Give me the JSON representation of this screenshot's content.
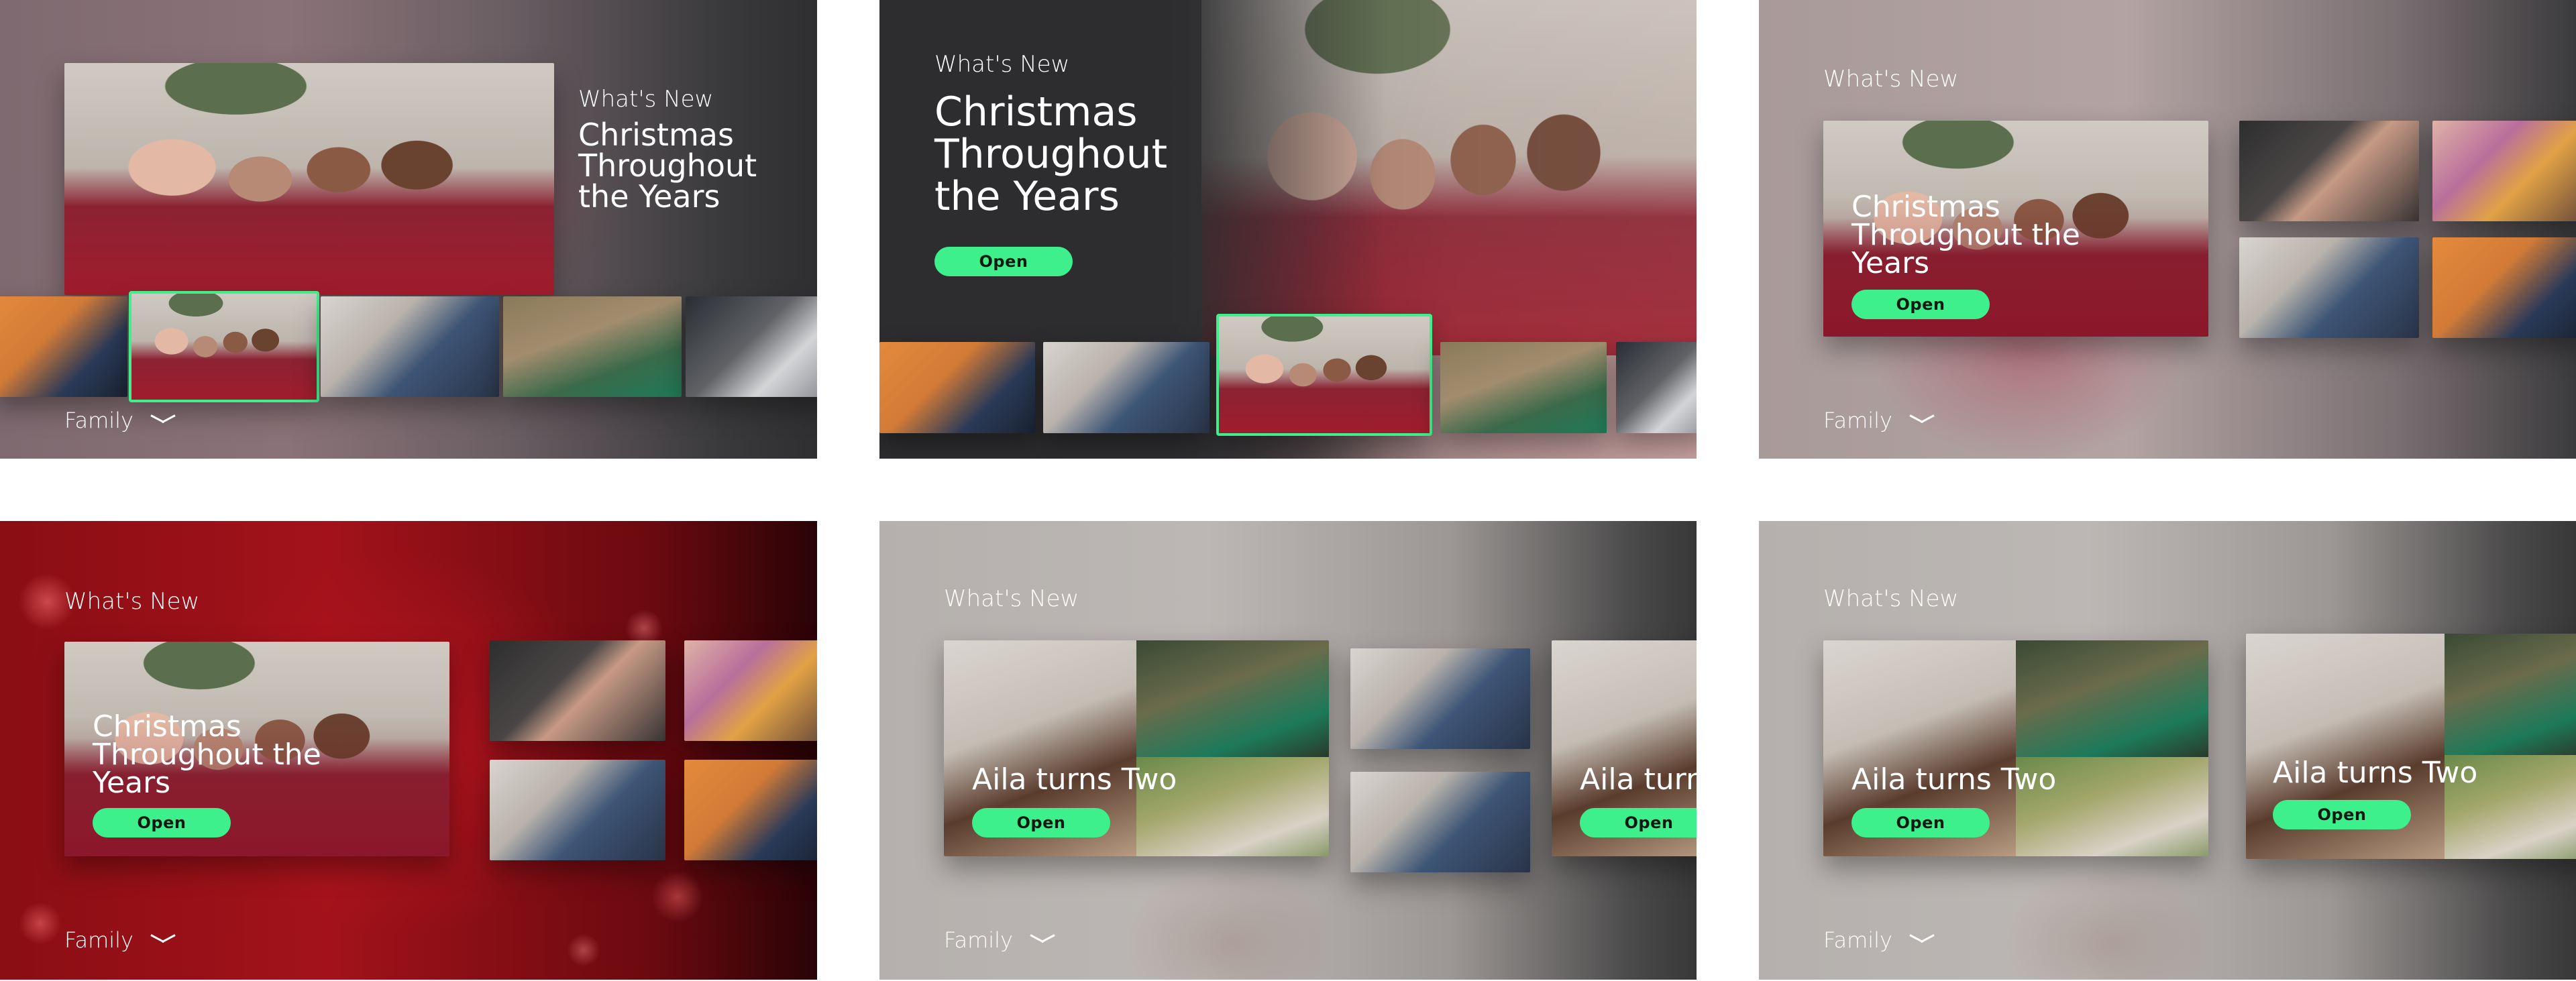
{
  "colors": {
    "accent": "#3ef08c"
  },
  "panels": [
    {
      "kicker": "What's New",
      "title": "Christmas Throughout the Years",
      "category": "Family"
    },
    {
      "kicker": "What's New",
      "title": "Christmas Throughout the Years",
      "button": "Open"
    },
    {
      "kicker": "What's New",
      "title": "Christmas Throughout the Years",
      "button": "Open",
      "category": "Family"
    },
    {
      "kicker": "What's New",
      "title": "Christmas Throughout the Years",
      "button": "Open",
      "category": "Family"
    },
    {
      "kicker": "What's New",
      "title": "Aila turns Two",
      "title_peek": "Aila turns Two",
      "button": "Open",
      "category": "Family"
    },
    {
      "kicker": "What's New",
      "title": "Aila turns Two",
      "title_peek": "Aila turns Two",
      "button": "Open",
      "category": "Family"
    }
  ],
  "icons": {
    "chevron": "chevron-down-icon"
  }
}
